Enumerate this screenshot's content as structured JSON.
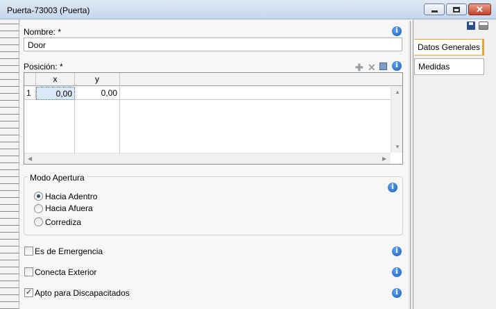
{
  "window": {
    "title": "Puerta-73003 (Puerta)",
    "controls": {
      "minimize_icon": "minimize-icon",
      "maximize_icon": "maximize-icon",
      "close_icon": "close-icon"
    }
  },
  "form": {
    "nombre": {
      "label": "Nombre: *",
      "value": "Door"
    },
    "posicion": {
      "label": "Posición: *",
      "columns": [
        "x",
        "y"
      ],
      "rows": [
        {
          "index": "1",
          "x": "0,00",
          "y": "0,00"
        }
      ],
      "toolbar": [
        "add-icon",
        "delete-icon",
        "square-icon",
        "info-icon"
      ]
    },
    "modo_apertura": {
      "title": "Modo Apertura",
      "options": [
        "Hacia Adentro",
        "Hacia Afuera",
        "Corrediza"
      ],
      "selected": "Hacia Adentro"
    },
    "checkboxes": [
      {
        "label": "Es de Emergencia",
        "checked": false
      },
      {
        "label": "Conecta Exterior",
        "checked": false
      },
      {
        "label": "Apto para Discapacitados",
        "checked": true
      }
    ]
  },
  "side": {
    "tabs": [
      {
        "label": "Datos Generales",
        "active": true
      },
      {
        "label": "Medidas",
        "active": false
      }
    ],
    "tools": [
      "save-icon",
      "print-icon"
    ]
  },
  "colors": {
    "accent": "#e8a234",
    "selection": "#dbe9fa",
    "info_blue": "#1a5db8"
  }
}
